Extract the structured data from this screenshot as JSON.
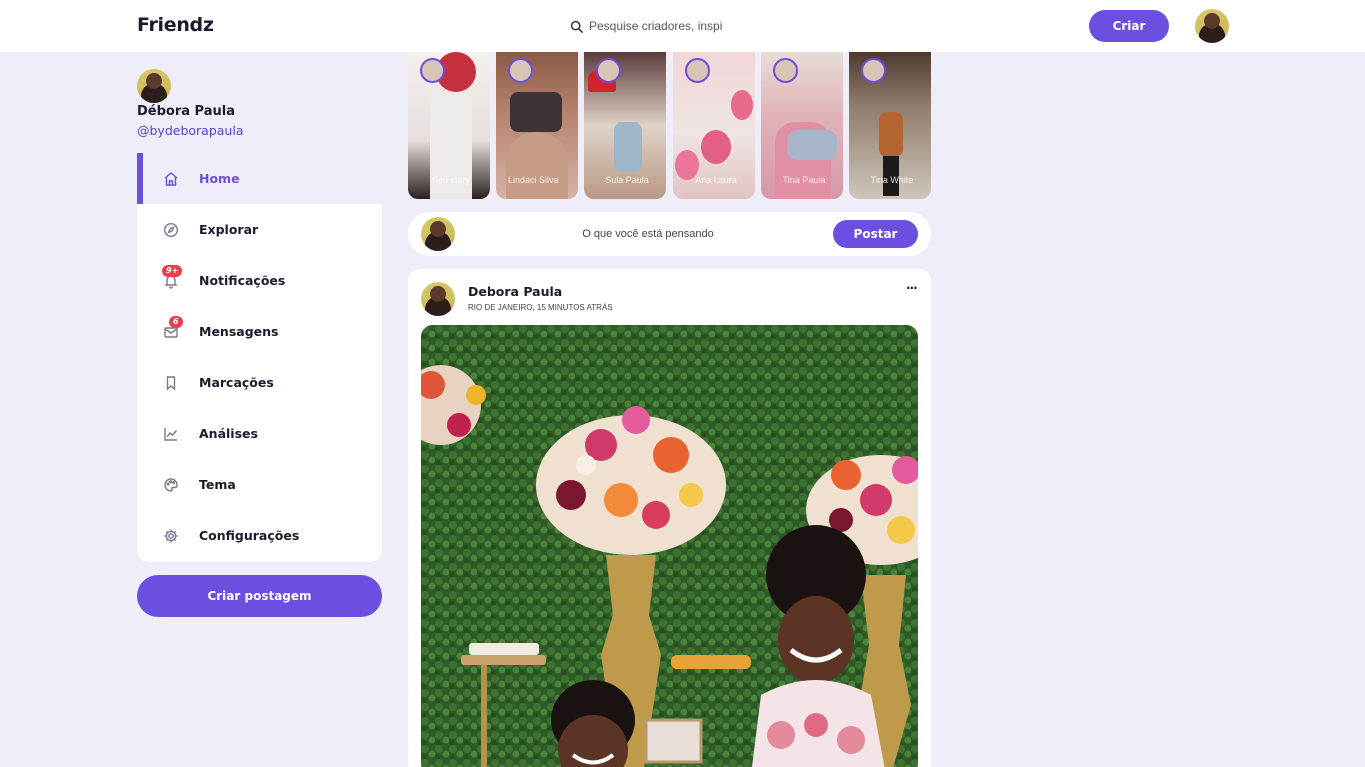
{
  "app": {
    "name": "Friendz"
  },
  "search": {
    "placeholder": "Pesquise criadores, inspi"
  },
  "header": {
    "create_label": "Criar"
  },
  "profile": {
    "name": "Débora Paula",
    "handle": "@bydeborapaula"
  },
  "sidebar": {
    "items": [
      {
        "label": "Home",
        "icon": "home-icon",
        "active": true
      },
      {
        "label": "Explorar",
        "icon": "compass-icon"
      },
      {
        "label": "Notificações",
        "icon": "bell-icon",
        "badge": "9+"
      },
      {
        "label": "Mensagens",
        "icon": "mail-icon",
        "badge": "6"
      },
      {
        "label": "Marcações",
        "icon": "bookmark-icon"
      },
      {
        "label": "Análises",
        "icon": "chart-icon"
      },
      {
        "label": "Tema",
        "icon": "palette-icon"
      },
      {
        "label": "Configurações",
        "icon": "gear-icon"
      }
    ],
    "create_post_label": "Criar postagem"
  },
  "stories": [
    {
      "name": "Seu story"
    },
    {
      "name": "Lindaci Silva"
    },
    {
      "name": "Sula Paula"
    },
    {
      "name": "Ana Laura"
    },
    {
      "name": "Tina Paula"
    },
    {
      "name": "Tina White"
    }
  ],
  "composer": {
    "placeholder": "O que você está pensando",
    "post_label": "Postar"
  },
  "feed": {
    "posts": [
      {
        "author": "Debora Paula",
        "meta": "RIO DE JANEIRO, 15 MINUTOS ATRÁS",
        "more": "···"
      }
    ]
  },
  "colors": {
    "accent": "#6c4fe0",
    "background": "#efedf7",
    "badge": "#ef3d4d"
  }
}
